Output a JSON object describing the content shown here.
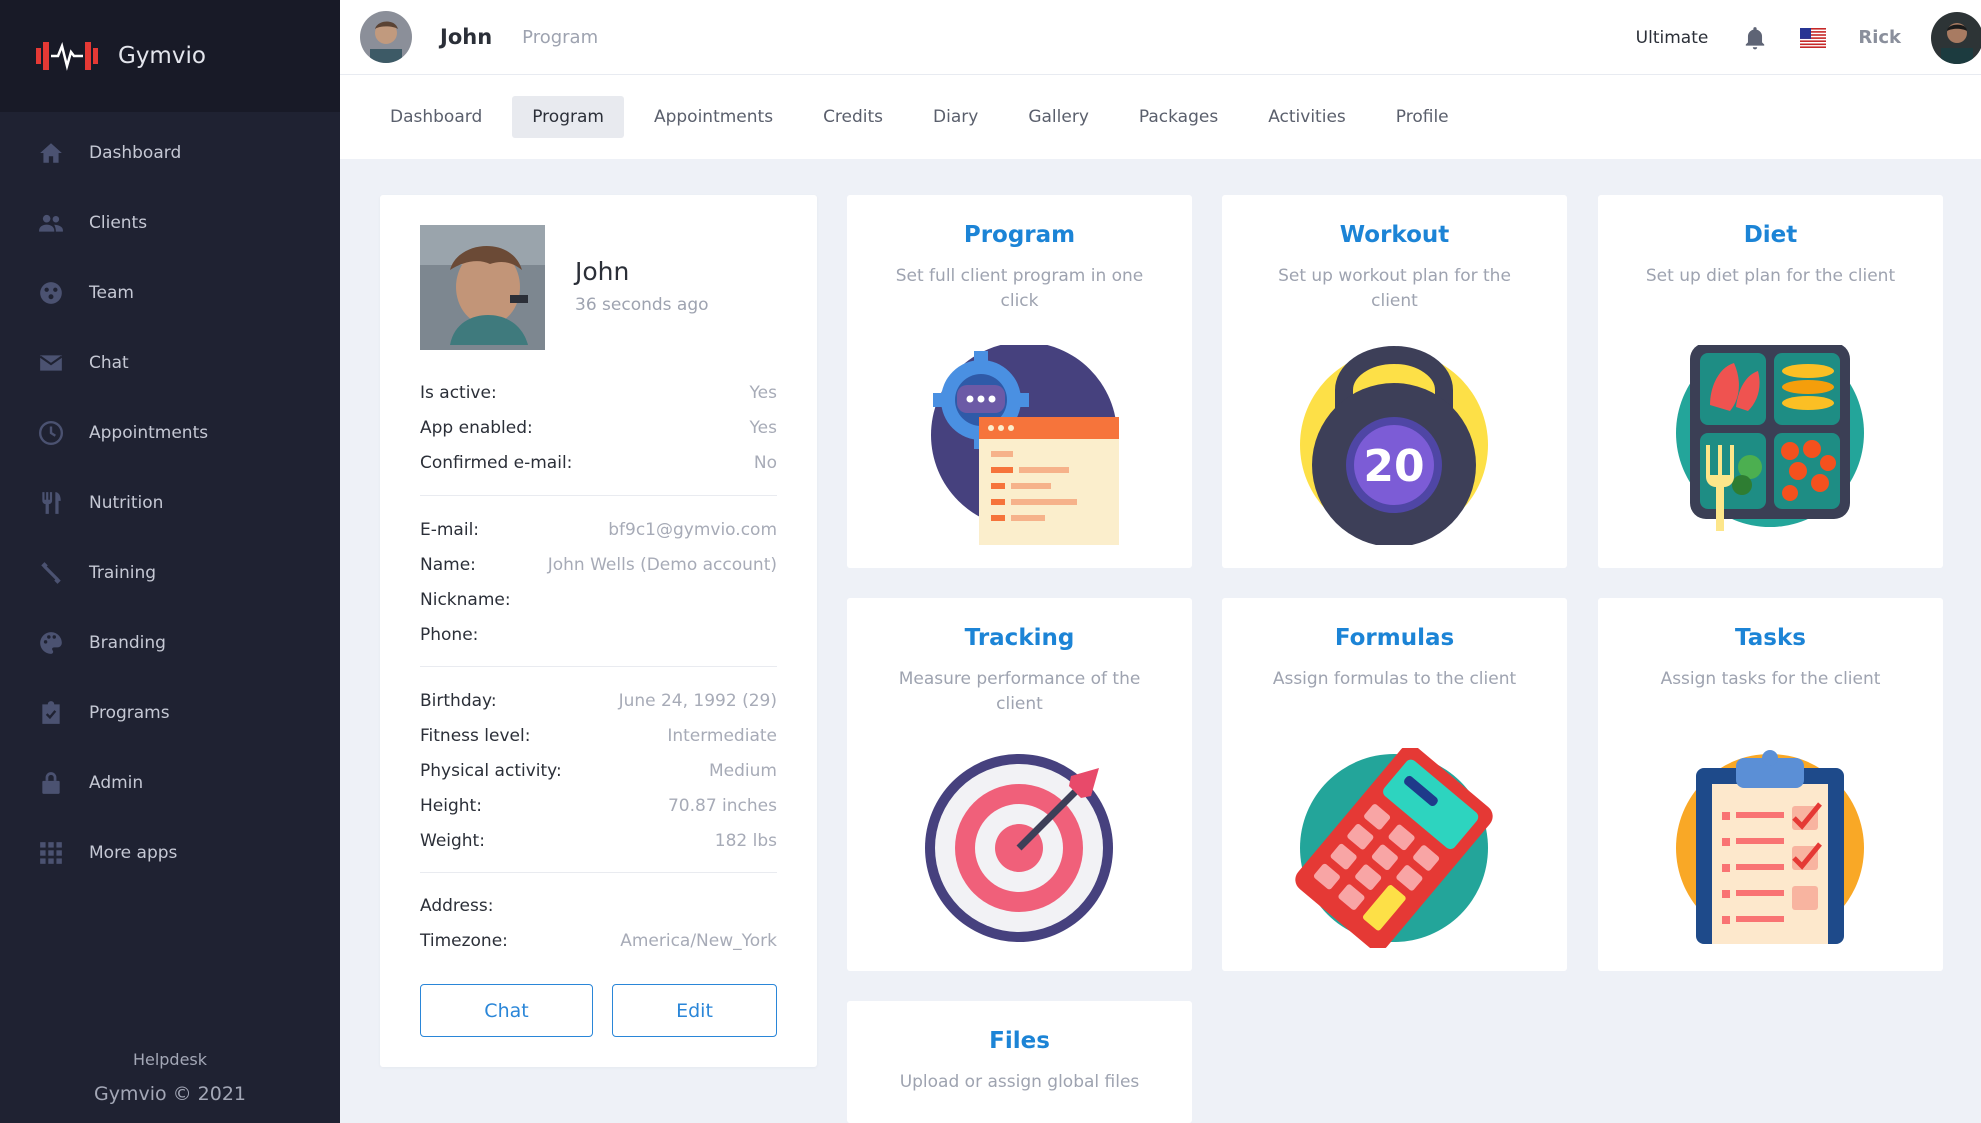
{
  "brand": {
    "name": "Gymvio",
    "accent": "#e53935"
  },
  "sidebar": {
    "items": [
      {
        "label": "Dashboard",
        "icon": "home-icon"
      },
      {
        "label": "Clients",
        "icon": "users-icon"
      },
      {
        "label": "Team",
        "icon": "team-icon"
      },
      {
        "label": "Chat",
        "icon": "mail-icon"
      },
      {
        "label": "Appointments",
        "icon": "clock-icon"
      },
      {
        "label": "Nutrition",
        "icon": "utensils-icon"
      },
      {
        "label": "Training",
        "icon": "dumbbell-icon"
      },
      {
        "label": "Branding",
        "icon": "palette-icon"
      },
      {
        "label": "Programs",
        "icon": "clipboard-check-icon"
      },
      {
        "label": "Admin",
        "icon": "lock-icon"
      },
      {
        "label": "More apps",
        "icon": "grid-icon"
      }
    ],
    "helpdesk": "Helpdesk",
    "copyright": "Gymvio © 2021"
  },
  "topbar": {
    "client_name": "John",
    "section": "Program",
    "plan": "Ultimate",
    "username": "Rick"
  },
  "tabs": [
    {
      "label": "Dashboard",
      "active": false
    },
    {
      "label": "Program",
      "active": true
    },
    {
      "label": "Appointments",
      "active": false
    },
    {
      "label": "Credits",
      "active": false
    },
    {
      "label": "Diary",
      "active": false
    },
    {
      "label": "Gallery",
      "active": false
    },
    {
      "label": "Packages",
      "active": false
    },
    {
      "label": "Activities",
      "active": false
    },
    {
      "label": "Profile",
      "active": false
    }
  ],
  "profile": {
    "name": "John",
    "last_seen": "36 seconds ago",
    "status": [
      {
        "k": "Is active:",
        "v": "Yes"
      },
      {
        "k": "App enabled:",
        "v": "Yes"
      },
      {
        "k": "Confirmed e-mail:",
        "v": "No"
      }
    ],
    "contact": [
      {
        "k": "E-mail:",
        "v": "bf9c1@gymvio.com"
      },
      {
        "k": "Name:",
        "v": "John Wells (Demo account)"
      },
      {
        "k": "Nickname:",
        "v": ""
      },
      {
        "k": "Phone:",
        "v": ""
      }
    ],
    "body": [
      {
        "k": "Birthday:",
        "v": "June 24, 1992 (29)"
      },
      {
        "k": "Fitness level:",
        "v": "Intermediate"
      },
      {
        "k": "Physical activity:",
        "v": "Medium"
      },
      {
        "k": "Height:",
        "v": "70.87 inches"
      },
      {
        "k": "Weight:",
        "v": "182 lbs"
      }
    ],
    "location": [
      {
        "k": "Address:",
        "v": ""
      },
      {
        "k": "Timezone:",
        "v": "America/New_York"
      }
    ],
    "chat_button": "Chat",
    "edit_button": "Edit"
  },
  "cards": [
    {
      "title": "Program",
      "desc": "Set full client program in one click",
      "icon": "program-gear-icon"
    },
    {
      "title": "Workout",
      "desc": "Set up workout plan for the client",
      "icon": "kettlebell-icon"
    },
    {
      "title": "Diet",
      "desc": "Set up diet plan for the client",
      "icon": "food-tray-icon"
    },
    {
      "title": "Tracking",
      "desc": "Measure performance of the client",
      "icon": "target-icon"
    },
    {
      "title": "Formulas",
      "desc": "Assign formulas to the client",
      "icon": "calculator-icon"
    },
    {
      "title": "Tasks",
      "desc": "Assign tasks for the client",
      "icon": "clipboard-icon"
    },
    {
      "title": "Files",
      "desc": "Upload or assign global files",
      "icon": "files-icon"
    }
  ],
  "colors": {
    "sidebar_bg": "#1f2232",
    "brand_bg": "#181a27",
    "link_blue": "#1c84d6",
    "page_bg": "#eef1f7"
  },
  "workout_badge": "20"
}
